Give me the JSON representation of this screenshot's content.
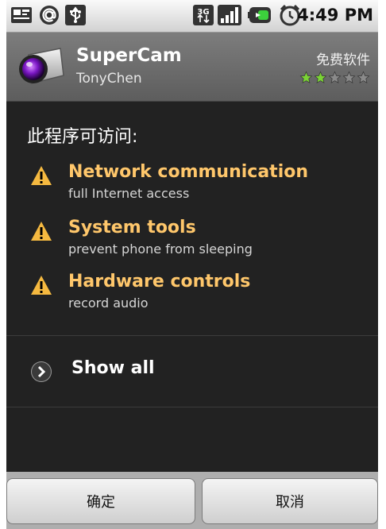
{
  "status_bar": {
    "time": "4:49 PM",
    "icons": [
      "sim-card-icon",
      "at-sign-icon",
      "usb-icon",
      "3g-icon",
      "signal-bars-icon",
      "battery-charging-icon",
      "alarm-clock-icon"
    ],
    "network_label": "3G"
  },
  "app": {
    "name": "SuperCam",
    "author": "TonyChen",
    "price": "免费软件",
    "rating": 2,
    "rating_max": 5
  },
  "intro": "此程序可访问:",
  "permissions": [
    {
      "title": "Network communication",
      "description": "full Internet access"
    },
    {
      "title": "System tools",
      "description": "prevent phone from sleeping"
    },
    {
      "title": "Hardware controls",
      "description": "record audio"
    }
  ],
  "show_all_label": "Show all",
  "buttons": {
    "confirm": "确定",
    "cancel": "取消"
  },
  "colors": {
    "permission_title": "#ffc76b",
    "rating_star": "#7bd335",
    "warning_icon": "#f5b940"
  }
}
